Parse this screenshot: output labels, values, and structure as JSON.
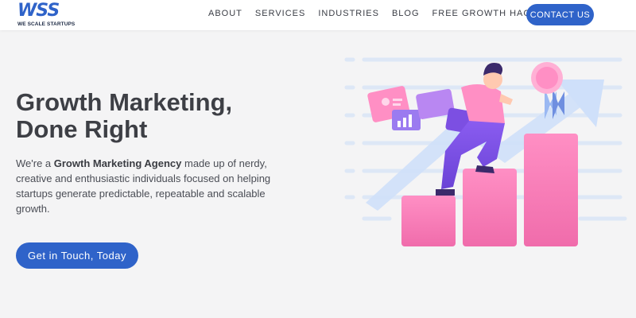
{
  "brand": {
    "logo_text": "WSS",
    "tagline": "WE SCALE STARTUPS",
    "accent_color": "#2f63c9"
  },
  "nav": {
    "items": [
      "ABOUT",
      "SERVICES",
      "INDUSTRIES",
      "BLOG",
      "FREE GROWTH HACKS"
    ],
    "contact_label": "CONTACT US"
  },
  "hero": {
    "title_line1": "Growth Marketing,",
    "title_line2": "Done Right",
    "desc_prefix": "We're a ",
    "desc_bold": "Growth Marketing Agency",
    "desc_suffix": " made up of nerdy, creative and enthusiastic individuals focused on helping startups generate predictable, repeatable and scalable growth.",
    "cta_label": "Get in Touch, Today"
  }
}
